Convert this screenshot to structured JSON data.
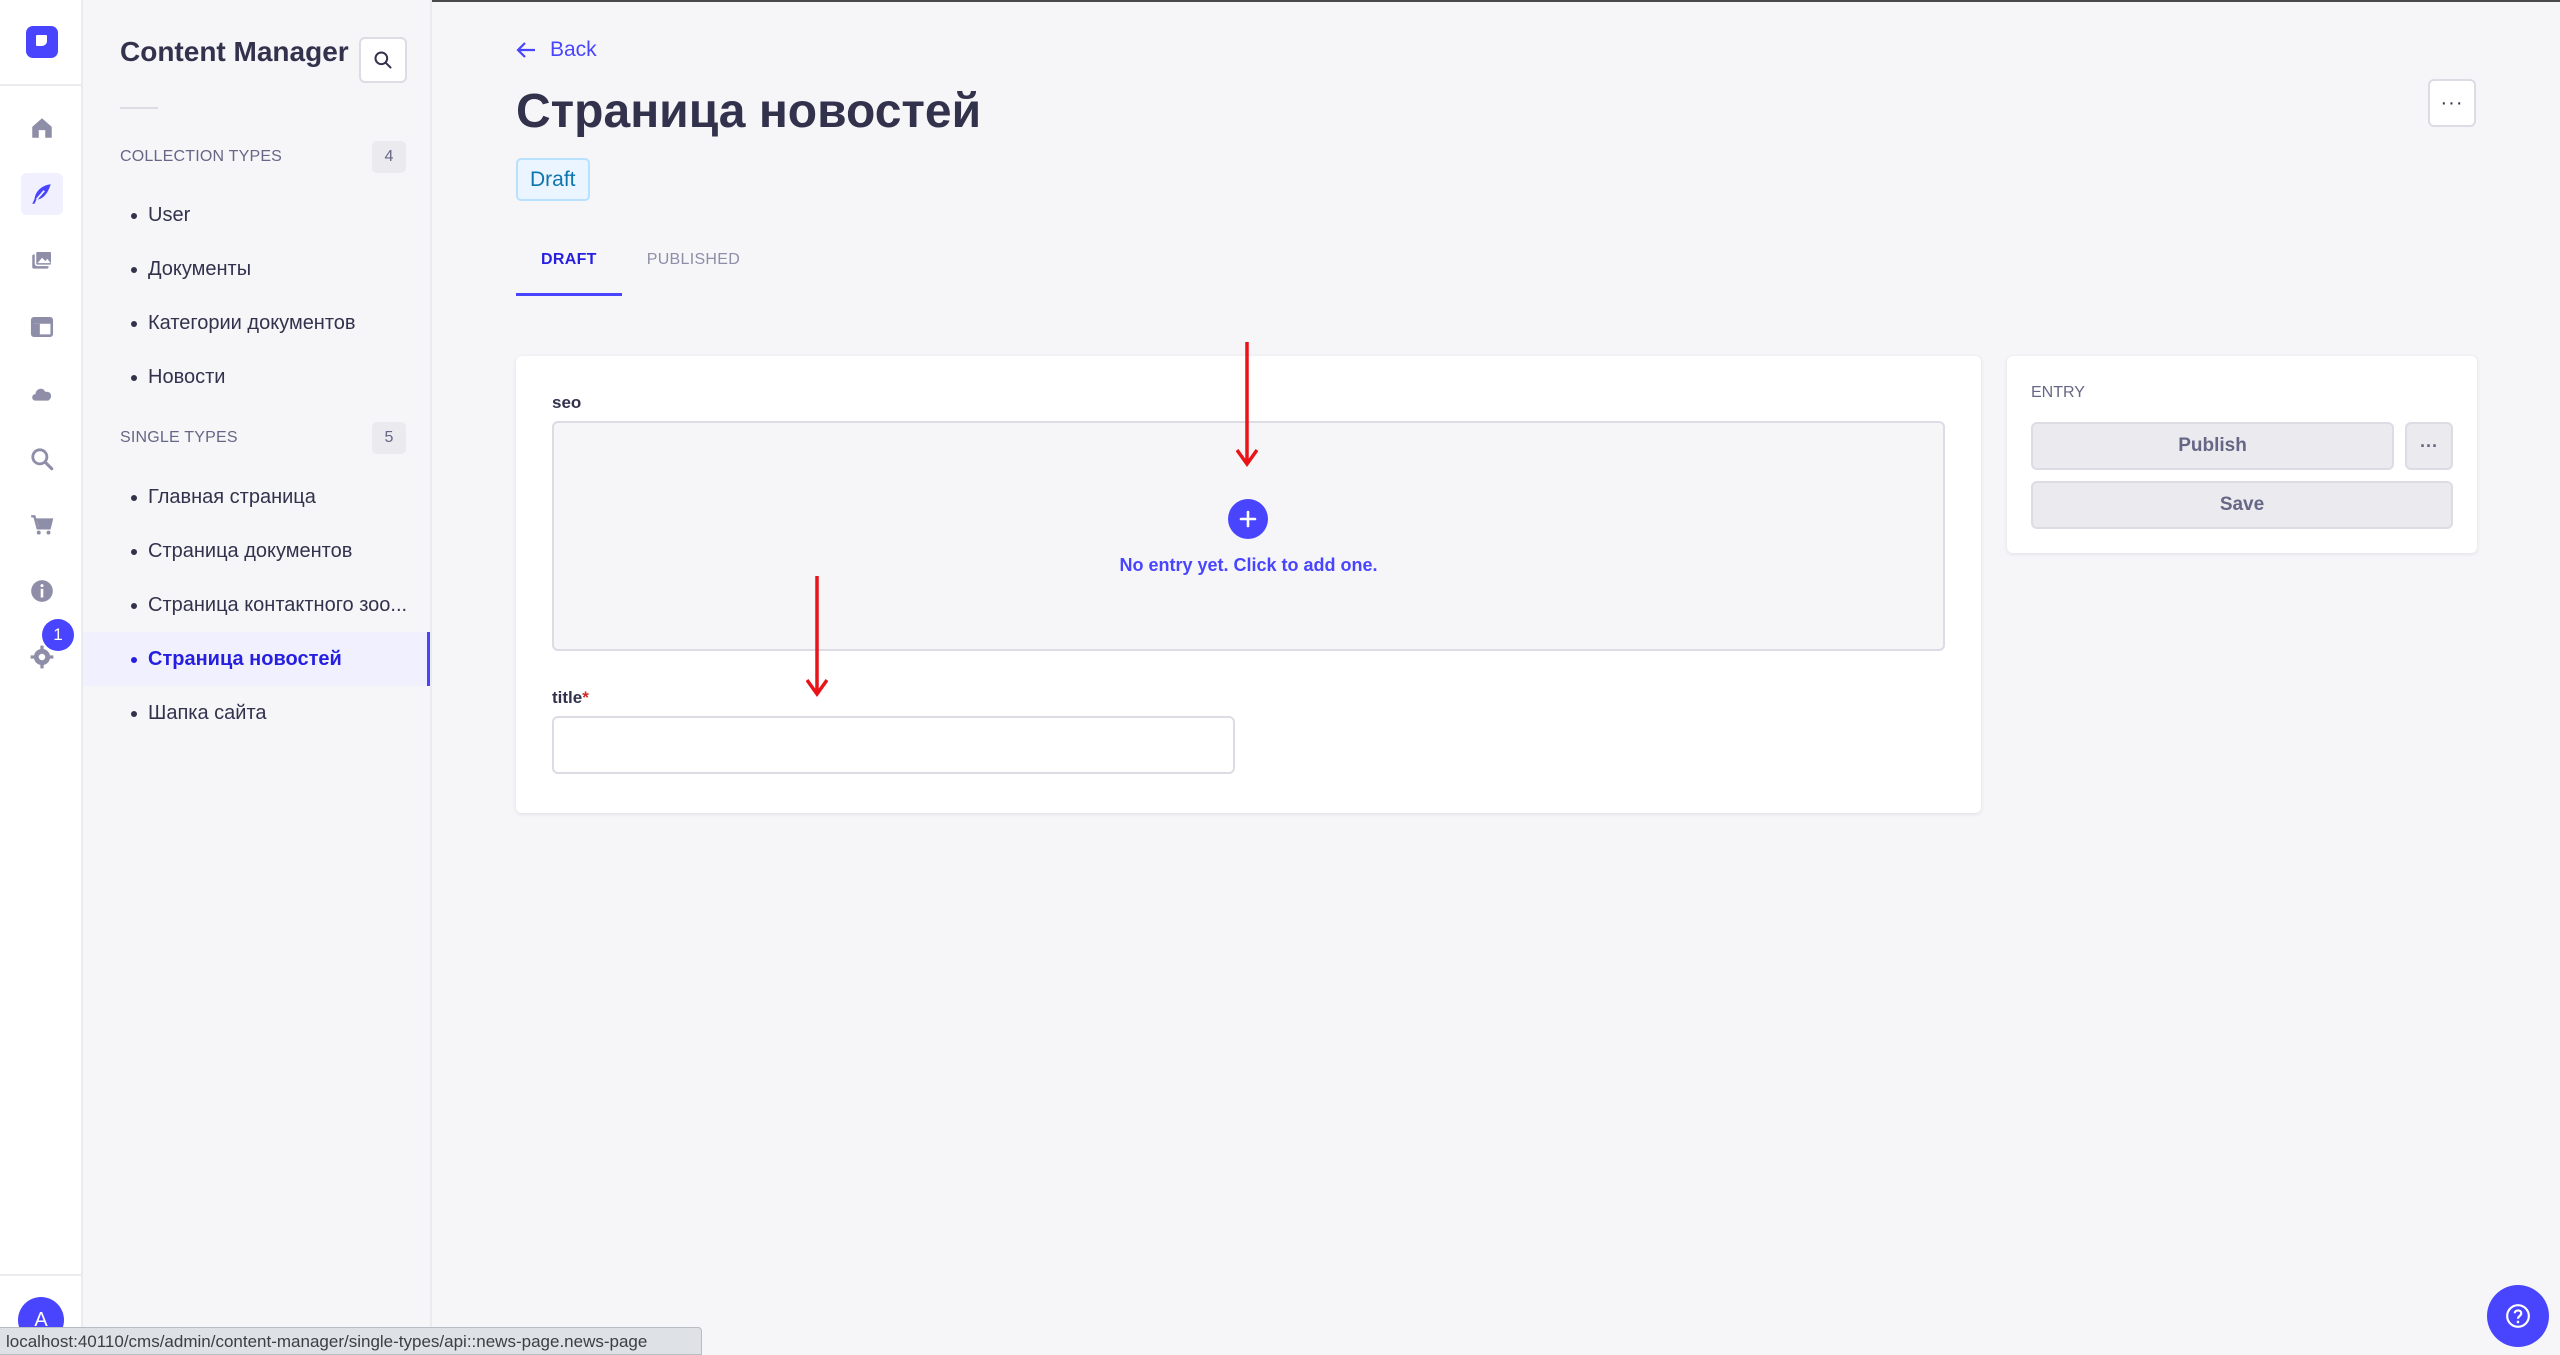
{
  "nav": {
    "items": [
      {
        "name": "home-icon",
        "active": false
      },
      {
        "name": "content-manager-icon",
        "active": true
      },
      {
        "name": "media-library-icon",
        "active": false
      },
      {
        "name": "content-type-builder-icon",
        "active": false
      },
      {
        "name": "cloud-icon",
        "active": false
      },
      {
        "name": "search-icon",
        "active": false
      },
      {
        "name": "cart-icon",
        "active": false
      },
      {
        "name": "info-icon",
        "active": false
      },
      {
        "name": "settings-icon",
        "active": false
      }
    ],
    "settings_badge": "1",
    "avatar_initial": "A",
    "accent_color": "#4945ff"
  },
  "subnav": {
    "title": "Content Manager",
    "collection_types": {
      "heading": "COLLECTION TYPES",
      "count": "4",
      "items": [
        "User",
        "Документы",
        "Категории документов",
        "Новости"
      ]
    },
    "single_types": {
      "heading": "SINGLE TYPES",
      "count": "5",
      "items": [
        "Главная страница",
        "Страница документов",
        "Страница контактного зоо...",
        "Страница новостей",
        "Шапка сайта"
      ],
      "active_index": 3
    }
  },
  "header": {
    "back_label": "Back",
    "title": "Страница новостей",
    "status_badge": "Draft",
    "more_label": "···"
  },
  "tabs": [
    {
      "label": "DRAFT",
      "active": true
    },
    {
      "label": "PUBLISHED",
      "active": false
    }
  ],
  "form": {
    "seo_label": "seo",
    "empty_component_text": "No entry yet. Click to add one.",
    "title_label": "title",
    "title_required_mark": "*",
    "title_value": ""
  },
  "entry_panel": {
    "heading": "ENTRY",
    "publish_label": "Publish",
    "more_label": "···",
    "save_label": "Save"
  },
  "status_bar": {
    "url": "localhost:40110/cms/admin/content-manager/single-types/api::news-page.news-page"
  }
}
